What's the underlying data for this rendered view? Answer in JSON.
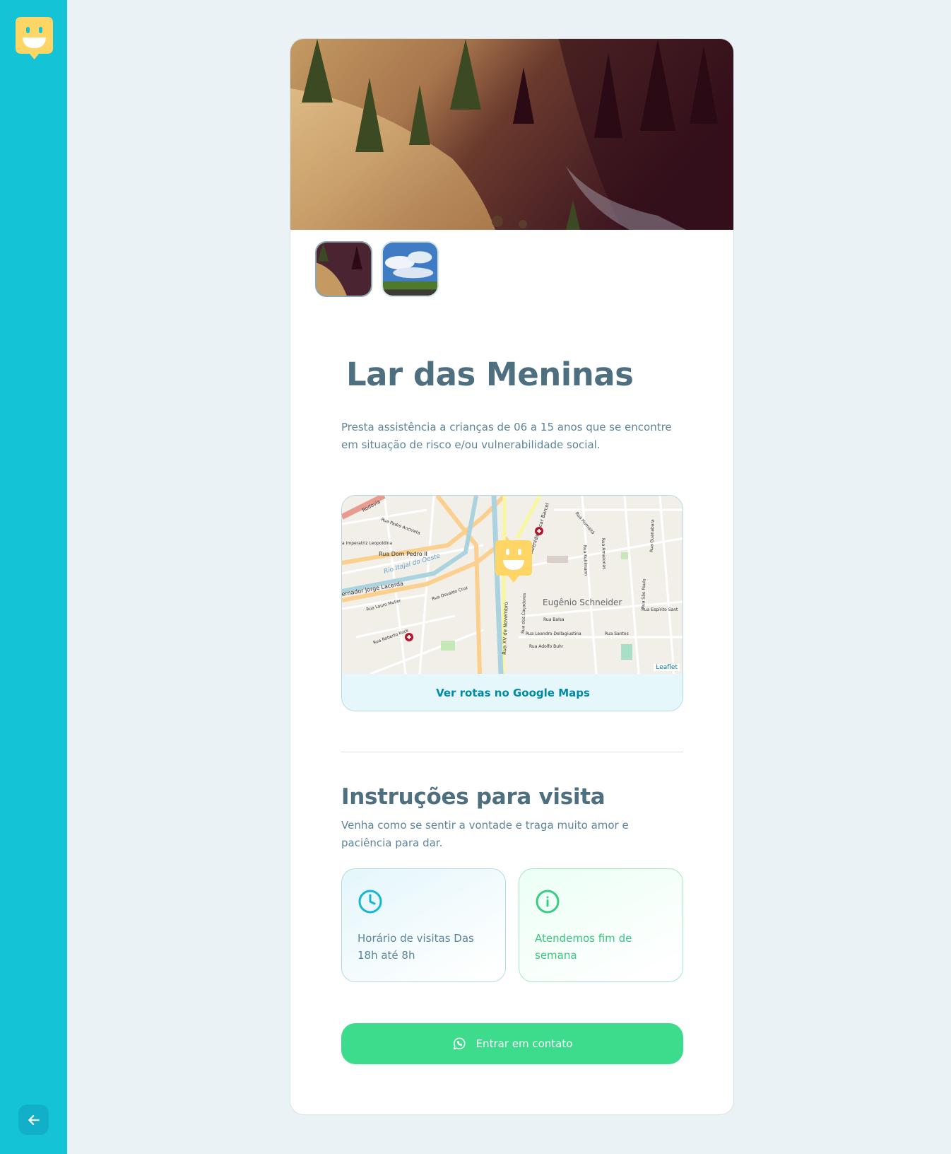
{
  "sidebar": {
    "logo_icon": "happy-marker-icon",
    "back_icon": "arrow-left-icon"
  },
  "orphanage": {
    "name": "Lar das Meninas",
    "about": "Presta assistência a crianças de 06 a 15 anos que se encontre em situação de risco e/ou vulnerabilidade social.",
    "images": [
      {
        "name": "hillside-photo"
      },
      {
        "name": "sky-field-photo"
      }
    ]
  },
  "map": {
    "link_label": "Ver rotas no Google Maps",
    "attribution": "Leaflet",
    "neighborhood": "Eugênio Schneider",
    "streets": {
      "dom_pedro": "Rua Dom Pedro II",
      "rio_itajai": "Rio Itajaí do Oeste",
      "jorge_lacerda": "ernador Jorge Lacerda",
      "xv_novembro": "Rua XV de Novembro",
      "oscar_barcelos": "Avenida Oscar Barcel",
      "imperatriz": "a Imperatriz Leopoldina",
      "padre_anchieta": "Rua Padre Anchieta",
      "lauro_muller": "Rua Lauro Muller",
      "osvaldo_cruz": "Rua Osvaldo Cruz",
      "roberto_kock": "Rua Roberto Kock",
      "balsa": "Rua Balsa",
      "leandro": "Rua Leandro Dellagiustina",
      "adolfo": "Rua Adolfo Buhr",
      "santos": "Rua Santos",
      "espirito_santo": "Rua Espírito Sant",
      "humaita": "Rua Humaitá",
      "amazonas": "Rua Amazonas",
      "guanabara": "Rua Guanabara",
      "sao_paulo": "Rua São Paulo",
      "kuhlmann": "Rua Kuhlmann",
      "rodovia": "Rodovia",
      "cacadores": "Rua dos Caçadores"
    }
  },
  "instructions": {
    "title": "Instruções para visita",
    "text": "Venha como se sentir a vontade e traga muito amor e paciência para dar.",
    "hours": "Horário de visitas Das 18h até 8h",
    "weekend": "Atendemos fim de semana",
    "hours_icon": "clock-icon",
    "weekend_icon": "info-icon"
  },
  "contact": {
    "label": "Entrar em contato",
    "icon": "whatsapp-icon"
  },
  "colors": {
    "sidebar": "#15c3d6",
    "title": "#4d6f80",
    "text": "#5c8599",
    "link": "#0089a5",
    "success": "#3cdc8c",
    "weekend_text": "#37c77f",
    "marker": "#ffd666"
  }
}
